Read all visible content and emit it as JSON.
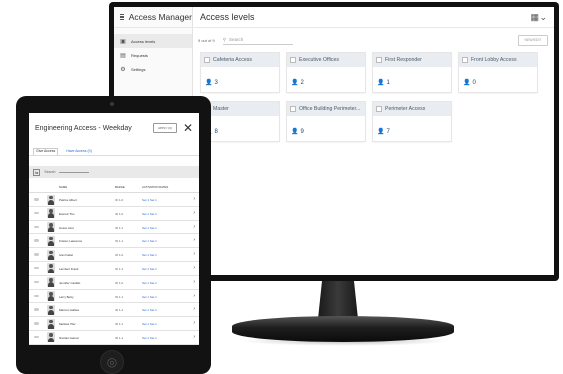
{
  "desktop": {
    "app_title": "Access Manager",
    "page_title": "Access levels",
    "sidebar": [
      {
        "label": "Access levels",
        "icon": "id-card-icon",
        "active": true
      },
      {
        "label": "Requests",
        "icon": "inbox-icon",
        "active": false
      },
      {
        "label": "Settings",
        "icon": "gear-icon",
        "active": false
      }
    ],
    "count_text": "9 out of 9",
    "search_placeholder": "Search",
    "new_button": "NEW/EDIT",
    "cards": [
      {
        "name": "Cafeteria Access",
        "count": "3"
      },
      {
        "name": "Executive Offices",
        "count": "2"
      },
      {
        "name": "First Responder",
        "count": "1"
      },
      {
        "name": "Front Lobby Access",
        "count": "0"
      },
      {
        "name": "Master",
        "count": "8"
      },
      {
        "name": "Office Building Perimeter...",
        "count": "9"
      },
      {
        "name": "Perimeter Access",
        "count": "7"
      }
    ]
  },
  "tablet": {
    "title": "Engineering Access - Weekday",
    "apply_button": "APPLY (0)",
    "tabs": [
      "Give Access",
      "Have Access (0)"
    ],
    "search_placeholder": "Search",
    "columns": [
      "NAME",
      "BADGE",
      "ACTIVATION DATES"
    ],
    "rows": [
      {
        "name": "Patrice Albert",
        "badge": "ID 1-0",
        "dates": "Set 1 Set 1"
      },
      {
        "name": "Everett Thu",
        "badge": "ID 1-0",
        "dates": "Set 1 Set 1"
      },
      {
        "name": "Grace Azer",
        "badge": "ID 1-1",
        "dates": "Set 1 Set 1"
      },
      {
        "name": "Kristen Lawrence",
        "badge": "ID 1-1",
        "dates": "Set 1 Set 1"
      },
      {
        "name": "Ivan Fabel",
        "badge": "ID 1-0",
        "dates": "Set 1 Set 1"
      },
      {
        "name": "Lambert Frank",
        "badge": "ID 1-1",
        "dates": "Set 1 Set 1"
      },
      {
        "name": "Jennifer Castillo",
        "badge": "ID 1-0",
        "dates": "Set 1 Set 1"
      },
      {
        "name": "Larry Betty",
        "badge": "ID 1-1",
        "dates": "Set 1 Set 1"
      },
      {
        "name": "Marcus Gables",
        "badge": "ID 1-1",
        "dates": "Set 1 Set 1"
      },
      {
        "name": "Melissa Tiler",
        "badge": "ID 1-1",
        "dates": "Set 1 Set 1"
      },
      {
        "name": "Nicolas Gamal",
        "badge": "ID 1-1",
        "dates": "Set 1 Set 1"
      }
    ]
  },
  "colors": {
    "accent": "#1f3f6f",
    "card_header": "#e9edf1",
    "link": "#2a6cd0"
  }
}
